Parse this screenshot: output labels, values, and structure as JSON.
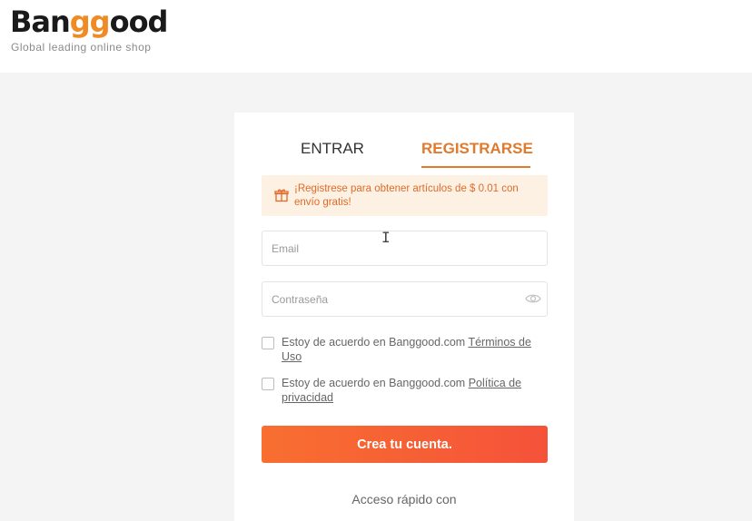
{
  "brand": {
    "logo_prefix": "Ban",
    "logo_highlight": "gg",
    "logo_suffix": "ood",
    "tagline": "Global leading online shop"
  },
  "tabs": {
    "login": "ENTRAR",
    "register": "REGISTRARSE",
    "active": "register"
  },
  "promo": {
    "icon": "gift-icon",
    "text": "¡Registrese para obtener artículos de $ 0.01 con envío gratis!"
  },
  "form": {
    "email_placeholder": "Email",
    "email_value": "",
    "password_placeholder": "Contraseña",
    "password_value": "",
    "password_icon": "eye-icon",
    "terms_prefix": "Estoy de acuerdo en Banggood.com ",
    "terms_link": "Términos de Uso",
    "terms_checked": false,
    "privacy_prefix": "Estoy de acuerdo en Banggood.com ",
    "privacy_link": "Política de privacidad",
    "privacy_checked": false,
    "submit_label": "Crea tu cuenta."
  },
  "quick_access": "Acceso rápido con",
  "colors": {
    "accent": "#e07a2c",
    "button_start": "#f86f30",
    "button_end": "#f5523a",
    "promo_bg": "#fdf1e4"
  }
}
